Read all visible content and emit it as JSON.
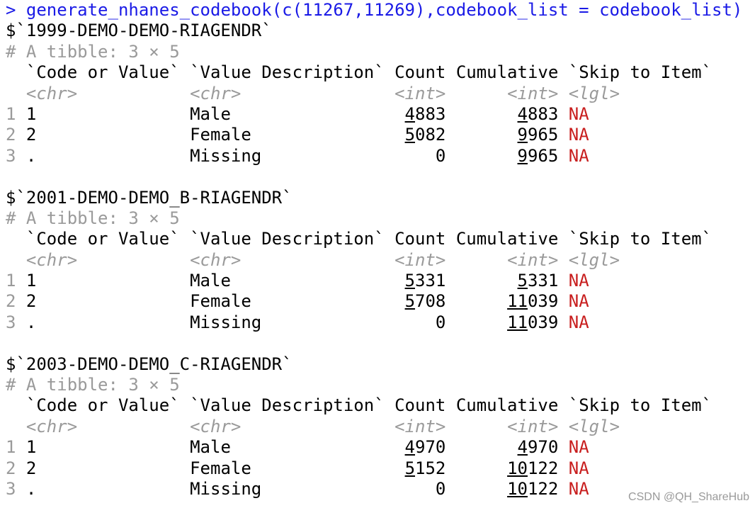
{
  "prompt": ">",
  "command": "generate_nhanes_codebook(c(11267,11269),codebook_list = codebook_list)",
  "watermark": "CSDN @QH_ShareHub",
  "colors": {
    "command": "#1a1ae6",
    "meta": "#9a9a9a",
    "na": "#c81e1e"
  },
  "tables": [
    {
      "name": "$`1999-DEMO-DEMO-RIAGENDR`",
      "meta": "# A tibble: 3 × 5",
      "columns": [
        "`Code or Value`",
        "`Value Description`",
        "Count",
        "Cumulative",
        "`Skip to Item`"
      ],
      "types": [
        "<chr>",
        "<chr>",
        "<int>",
        "<int>",
        "<lgl>"
      ],
      "rows": [
        {
          "idx": "1",
          "code": "1",
          "desc": "Male",
          "count": "4883",
          "cum": "4883",
          "skip": "NA"
        },
        {
          "idx": "2",
          "code": "2",
          "desc": "Female",
          "count": "5082",
          "cum": "9965",
          "skip": "NA"
        },
        {
          "idx": "3",
          "code": ".",
          "desc": "Missing",
          "count": "0",
          "cum": "9965",
          "skip": "NA"
        }
      ]
    },
    {
      "name": "$`2001-DEMO-DEMO_B-RIAGENDR`",
      "meta": "# A tibble: 3 × 5",
      "columns": [
        "`Code or Value`",
        "`Value Description`",
        "Count",
        "Cumulative",
        "`Skip to Item`"
      ],
      "types": [
        "<chr>",
        "<chr>",
        "<int>",
        "<int>",
        "<lgl>"
      ],
      "rows": [
        {
          "idx": "1",
          "code": "1",
          "desc": "Male",
          "count": "5331",
          "cum": "5331",
          "skip": "NA"
        },
        {
          "idx": "2",
          "code": "2",
          "desc": "Female",
          "count": "5708",
          "cum": "11039",
          "skip": "NA"
        },
        {
          "idx": "3",
          "code": ".",
          "desc": "Missing",
          "count": "0",
          "cum": "11039",
          "skip": "NA"
        }
      ]
    },
    {
      "name": "$`2003-DEMO-DEMO_C-RIAGENDR`",
      "meta": "# A tibble: 3 × 5",
      "columns": [
        "`Code or Value`",
        "`Value Description`",
        "Count",
        "Cumulative",
        "`Skip to Item`"
      ],
      "types": [
        "<chr>",
        "<chr>",
        "<int>",
        "<int>",
        "<lgl>"
      ],
      "rows": [
        {
          "idx": "1",
          "code": "1",
          "desc": "Male",
          "count": "4970",
          "cum": "4970",
          "skip": "NA"
        },
        {
          "idx": "2",
          "code": "2",
          "desc": "Female",
          "count": "5152",
          "cum": "10122",
          "skip": "NA"
        },
        {
          "idx": "3",
          "code": ".",
          "desc": "Missing",
          "count": "0",
          "cum": "10122",
          "skip": "NA"
        }
      ]
    }
  ]
}
